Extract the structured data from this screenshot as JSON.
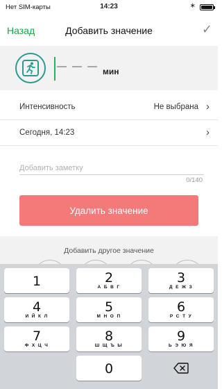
{
  "status_bar": {
    "carrier": "Нет SIM-карты",
    "time": "14:23",
    "bluetooth": "∗"
  },
  "nav": {
    "back_label": "Назад",
    "title": "Добавить значение",
    "done_icon": "✓"
  },
  "value": {
    "unit": "мин"
  },
  "rows": {
    "intensity": {
      "label": "Интенсивность",
      "value": "Не выбрана"
    },
    "datetime": {
      "label": "Сегодня, 14:23"
    }
  },
  "note": {
    "placeholder": "Добавить заметку",
    "counter": "0/140"
  },
  "delete_label": "Удалить значение",
  "other": {
    "label": "Добавить другое значение"
  },
  "keypad": {
    "keys": [
      {
        "digit": "1",
        "letters": ""
      },
      {
        "digit": "2",
        "letters": "А Б В Г"
      },
      {
        "digit": "3",
        "letters": "Д Е Ж З"
      },
      {
        "digit": "4",
        "letters": "И Й К Л"
      },
      {
        "digit": "5",
        "letters": "М Н О П"
      },
      {
        "digit": "6",
        "letters": "Р С Т У"
      },
      {
        "digit": "7",
        "letters": "Ф Х Ц Ч"
      },
      {
        "digit": "8",
        "letters": "Ш Щ Ъ Ы"
      },
      {
        "digit": "9",
        "letters": "Ь Э Ю Я"
      },
      {
        "digit": "0",
        "letters": ""
      }
    ]
  },
  "colors": {
    "accent_green": "#1aa34a",
    "delete_red": "#f47a7a",
    "icon_teal": "#2a9a90"
  }
}
